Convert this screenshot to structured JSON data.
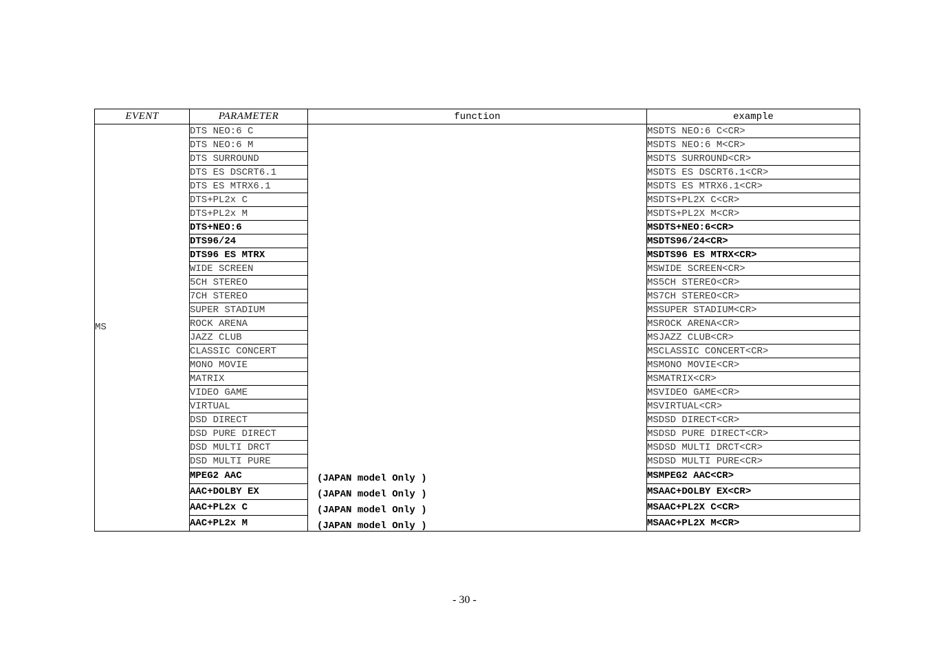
{
  "table": {
    "headers": {
      "event": "EVENT",
      "parameter": "PARAMETER",
      "function": "function",
      "example": "example"
    },
    "event_value": "MS",
    "rows": [
      {
        "parameter": "DTS NEO:6 C",
        "example": "MSDTS NEO:6 C<CR>",
        "bold": false,
        "note": ""
      },
      {
        "parameter": "DTS NEO:6 M",
        "example": "MSDTS NEO:6 M<CR>",
        "bold": false,
        "note": ""
      },
      {
        "parameter": "DTS SURROUND",
        "example": "MSDTS SURROUND<CR>",
        "bold": false,
        "note": ""
      },
      {
        "parameter": "DTS ES DSCRT6.1",
        "example": "MSDTS ES DSCRT6.1<CR>",
        "bold": false,
        "note": ""
      },
      {
        "parameter": "DTS ES MTRX6.1",
        "example": "MSDTS ES MTRX6.1<CR>",
        "bold": false,
        "note": ""
      },
      {
        "parameter": "DTS+PL2x C",
        "example": "MSDTS+PL2X C<CR>",
        "bold": false,
        "note": ""
      },
      {
        "parameter": "DTS+PL2x M",
        "example": "MSDTS+PL2X M<CR>",
        "bold": false,
        "note": ""
      },
      {
        "parameter": "DTS+NEO:6",
        "example": "MSDTS+NEO:6<CR>",
        "bold": true,
        "note": ""
      },
      {
        "parameter": "DTS96/24",
        "example": "MSDTS96/24<CR>",
        "bold": true,
        "note": ""
      },
      {
        "parameter": "DTS96 ES MTRX",
        "example": "MSDTS96 ES MTRX<CR>",
        "bold": true,
        "note": ""
      },
      {
        "parameter": "WIDE SCREEN",
        "example": "MSWIDE SCREEN<CR>",
        "bold": false,
        "note": ""
      },
      {
        "parameter": "5CH STEREO",
        "example": "MS5CH STEREO<CR>",
        "bold": false,
        "note": ""
      },
      {
        "parameter": "7CH STEREO",
        "example": "MS7CH STEREO<CR>",
        "bold": false,
        "note": ""
      },
      {
        "parameter": "SUPER STADIUM",
        "example": "MSSUPER STADIUM<CR>",
        "bold": false,
        "note": ""
      },
      {
        "parameter": "ROCK ARENA",
        "example": "MSROCK ARENA<CR>",
        "bold": false,
        "note": ""
      },
      {
        "parameter": "JAZZ CLUB",
        "example": "MSJAZZ CLUB<CR>",
        "bold": false,
        "note": ""
      },
      {
        "parameter": "CLASSIC CONCERT",
        "example": "MSCLASSIC CONCERT<CR>",
        "bold": false,
        "note": ""
      },
      {
        "parameter": "MONO MOVIE",
        "example": "MSMONO MOVIE<CR>",
        "bold": false,
        "note": ""
      },
      {
        "parameter": "MATRIX",
        "example": "MSMATRIX<CR>",
        "bold": false,
        "note": ""
      },
      {
        "parameter": "VIDEO GAME",
        "example": "MSVIDEO GAME<CR>",
        "bold": false,
        "note": ""
      },
      {
        "parameter": "VIRTUAL",
        "example": "MSVIRTUAL<CR>",
        "bold": false,
        "note": ""
      },
      {
        "parameter": "DSD DIRECT",
        "example": "MSDSD DIRECT<CR>",
        "bold": false,
        "note": ""
      },
      {
        "parameter": "DSD PURE DIRECT",
        "example": "MSDSD PURE DIRECT<CR>",
        "bold": false,
        "note": ""
      },
      {
        "parameter": "DSD MULTI DRCT",
        "example": "MSDSD MULTI DRCT<CR>",
        "bold": false,
        "note": ""
      },
      {
        "parameter": "DSD MULTI PURE",
        "example": "MSDSD MULTI PURE<CR>",
        "bold": false,
        "note": ""
      },
      {
        "parameter": "MPEG2 AAC",
        "example": "MSMPEG2 AAC<CR>",
        "bold": true,
        "note": "(JAPAN model Only )"
      },
      {
        "parameter": "AAC+DOLBY EX",
        "example": "MSAAC+DOLBY EX<CR>",
        "bold": true,
        "note": "(JAPAN model Only )"
      },
      {
        "parameter": "AAC+PL2x C",
        "example": "MSAAC+PL2X C<CR>",
        "bold": true,
        "note": "(JAPAN model Only )"
      },
      {
        "parameter": "AAC+PL2x M",
        "example": "MSAAC+PL2X M<CR>",
        "bold": true,
        "note": "(JAPAN model Only )"
      }
    ]
  },
  "footer": {
    "page_number": "- 30 -"
  }
}
